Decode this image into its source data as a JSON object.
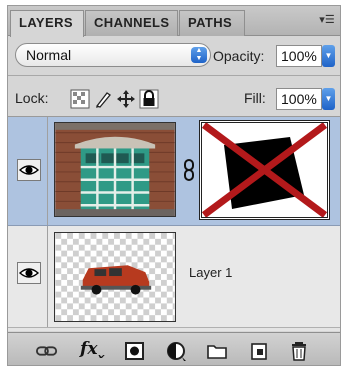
{
  "tabs": [
    {
      "label": "LAYERS",
      "active": true
    },
    {
      "label": "CHANNELS",
      "active": false
    },
    {
      "label": "PATHS",
      "active": false
    }
  ],
  "panel_menu_icon": "panel-menu-icon",
  "blend_mode": {
    "value": "Normal"
  },
  "opacity": {
    "label": "Opacity:",
    "value": "100%"
  },
  "lock": {
    "label": "Lock:",
    "buttons": [
      "lock-transparent-pixels-icon",
      "lock-image-pixels-icon",
      "lock-position-icon",
      "lock-all-icon"
    ]
  },
  "fill": {
    "label": "Fill:",
    "value": "100%"
  },
  "layers": [
    {
      "name": "",
      "visible": true,
      "selected": true,
      "has_mask": true
    },
    {
      "name": "Layer 1",
      "visible": true,
      "selected": false,
      "has_mask": false
    }
  ],
  "toolbar_icons": [
    "link-layers-icon",
    "fx-icon",
    "add-mask-icon",
    "adjustment-layer-icon",
    "new-group-icon",
    "new-layer-icon",
    "trash-icon"
  ],
  "toolbar_fx_label": "fx",
  "colors": {
    "selection": "#aec3e0",
    "accent": "#1f63c8",
    "mask_x": "#b3191b"
  }
}
